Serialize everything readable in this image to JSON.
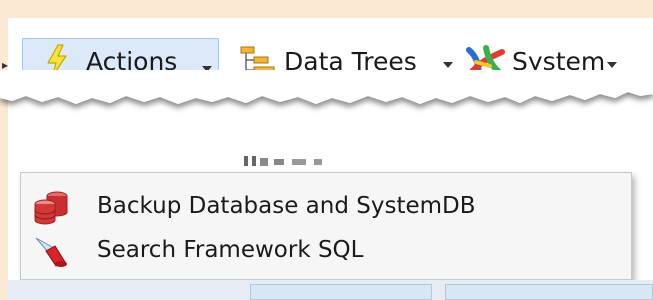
{
  "toolbar": {
    "actions_label_underlined": "A",
    "actions_label_rest": "ctions",
    "data_trees_label_a": "Data ",
    "data_trees_label_underlined": "T",
    "data_trees_label_b": "rees",
    "system_label_underlined": "S",
    "system_label_rest": "ystem"
  },
  "menu": {
    "items": [
      {
        "label": "Backup Database and SystemDB",
        "icon": "database-stack-icon"
      },
      {
        "label": "Search Framework SQL",
        "icon": "flashlight-icon"
      }
    ]
  },
  "colors": {
    "page_background": "#fbe9d3",
    "button_highlight": "#dbe9f8",
    "menu_background": "#f6f6f6"
  }
}
